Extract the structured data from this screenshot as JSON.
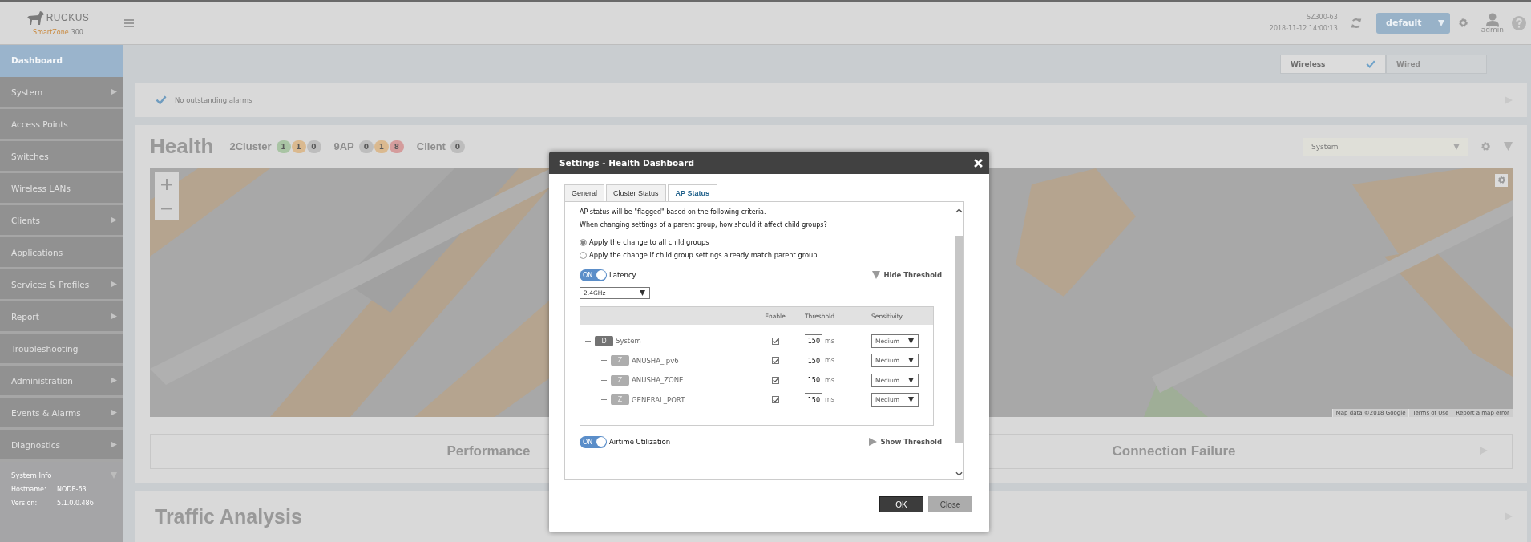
{
  "header": {
    "logo_text": "RUCKUS",
    "product": "SmartZone",
    "model": "300",
    "hostname": "SZ300-63",
    "datetime": "2018-11-12  14:00:13",
    "domain_button": "default",
    "user": "admin"
  },
  "sidebar": {
    "items": [
      {
        "label": "Dashboard",
        "selected": true,
        "has_submenu": false
      },
      {
        "label": "System",
        "selected": false,
        "has_submenu": true
      },
      {
        "label": "Access Points",
        "selected": false,
        "has_submenu": false
      },
      {
        "label": "Switches",
        "selected": false,
        "has_submenu": false
      },
      {
        "label": "Wireless LANs",
        "selected": false,
        "has_submenu": false
      },
      {
        "label": "Clients",
        "selected": false,
        "has_submenu": true
      },
      {
        "label": "Applications",
        "selected": false,
        "has_submenu": false
      },
      {
        "label": "Services & Profiles",
        "selected": false,
        "has_submenu": true
      },
      {
        "label": "Report",
        "selected": false,
        "has_submenu": true
      },
      {
        "label": "Troubleshooting",
        "selected": false,
        "has_submenu": false
      },
      {
        "label": "Administration",
        "selected": false,
        "has_submenu": true
      },
      {
        "label": "Events & Alarms",
        "selected": false,
        "has_submenu": true
      },
      {
        "label": "Diagnostics",
        "selected": false,
        "has_submenu": true
      }
    ],
    "system_info": {
      "title": "System Info",
      "expanded": true,
      "fields": [
        {
          "label": "Hostname:",
          "value": "NODE-63"
        },
        {
          "label": "Version:",
          "value": "5.1.0.0.486"
        }
      ]
    }
  },
  "view_toggle": [
    {
      "label": "Wireless",
      "selected": true
    },
    {
      "label": "Wired",
      "selected": false
    }
  ],
  "alarm_bar": {
    "text": "No outstanding alarms"
  },
  "health": {
    "title": "Health",
    "groups": [
      {
        "label": "2Cluster",
        "counts": [
          {
            "value": "1",
            "color": "#a9c4a4"
          },
          {
            "value": "1",
            "color": "#dab98f"
          },
          {
            "value": "0",
            "color": "#bdbdbd"
          }
        ]
      },
      {
        "label": "9AP",
        "counts": [
          {
            "value": "0",
            "color": "#bdbdbd"
          },
          {
            "value": "1",
            "color": "#dab98f"
          },
          {
            "value": "8",
            "color": "#d49c9c"
          }
        ]
      },
      {
        "label": "Client",
        "counts": [
          {
            "value": "0",
            "color": "#bdbdbd"
          }
        ]
      }
    ],
    "scope_select": "System",
    "map": {
      "kind": "picture",
      "attribution": [
        "Map data ©2018 Google",
        "Terms of Use",
        "Report a map error"
      ]
    },
    "cards": [
      {
        "title": "Performance"
      },
      {
        "title": "Connection Failure",
        "arrow": true
      }
    ]
  },
  "traffic": {
    "title": "Traffic Analysis"
  },
  "dialog": {
    "title": "Settings - Health Dashboard",
    "tabs": [
      {
        "label": "General",
        "selected": false
      },
      {
        "label": "Cluster Status",
        "selected": false
      },
      {
        "label": "AP Status",
        "selected": true
      }
    ],
    "intro": "AP status will be \"flagged\" based on the following criteria.",
    "question": "When changing settings of a parent group, how should it affect child groups?",
    "options": [
      {
        "label": "Apply the change to all child groups",
        "selected": true
      },
      {
        "label": "Apply the change if child group settings already match parent group",
        "selected": false
      }
    ],
    "criteria": [
      {
        "label": "Latency",
        "on": true,
        "toggle_text": "ON",
        "threshold_link": "Hide Threshold",
        "expanded": true,
        "band": "2.4GHz",
        "columns": [
          "Enable",
          "Threshold",
          "Sensitivity"
        ],
        "rows": [
          {
            "kind": "domain",
            "badge": "D",
            "name": "System",
            "expanded": true,
            "enabled": true,
            "threshold": "150",
            "unit": "ms",
            "sensitivity": "Medium",
            "children": [
              {
                "kind": "zone",
                "badge": "Z",
                "name": "ANUSHA_Ipv6",
                "expanded": false,
                "enabled": true,
                "threshold": "150",
                "unit": "ms",
                "sensitivity": "Medium"
              },
              {
                "kind": "zone",
                "badge": "Z",
                "name": "ANUSHA_ZONE",
                "expanded": false,
                "enabled": true,
                "threshold": "150",
                "unit": "ms",
                "sensitivity": "Medium"
              },
              {
                "kind": "zone",
                "badge": "Z",
                "name": "GENERAL_PORT",
                "expanded": false,
                "enabled": true,
                "threshold": "150",
                "unit": "ms",
                "sensitivity": "Medium"
              }
            ]
          }
        ]
      },
      {
        "label": "Airtime Utilization",
        "on": true,
        "toggle_text": "ON",
        "threshold_link": "Show Threshold",
        "expanded": false
      }
    ],
    "buttons": [
      {
        "label": "OK",
        "kind": "primary"
      },
      {
        "label": "Close",
        "kind": "secondary"
      }
    ]
  }
}
